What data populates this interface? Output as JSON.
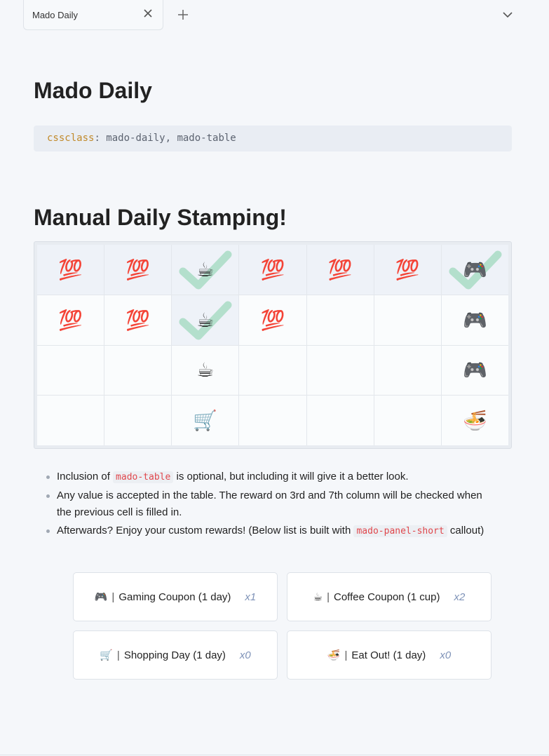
{
  "tabs": {
    "active_title": "Mado Daily",
    "close_icon": "close-icon",
    "new_tab_icon": "plus-icon",
    "menu_icon": "chevron-down-icon"
  },
  "page": {
    "title": "Mado Daily",
    "frontmatter_key": "cssclass",
    "frontmatter_sep": ":",
    "frontmatter_value": " mado-daily, mado-table",
    "heading": "Manual Daily Stamping!"
  },
  "stamp_table": {
    "rows": [
      [
        {
          "v": "💯",
          "filled": true,
          "checked": false
        },
        {
          "v": "💯",
          "filled": true,
          "checked": false
        },
        {
          "v": "☕",
          "filled": true,
          "checked": true
        },
        {
          "v": "💯",
          "filled": true,
          "checked": false
        },
        {
          "v": "💯",
          "filled": true,
          "checked": false
        },
        {
          "v": "💯",
          "filled": true,
          "checked": false
        },
        {
          "v": "🎮",
          "filled": true,
          "checked": true
        }
      ],
      [
        {
          "v": "💯",
          "filled": false,
          "checked": false
        },
        {
          "v": "💯",
          "filled": false,
          "checked": false
        },
        {
          "v": "☕",
          "filled": true,
          "checked": true
        },
        {
          "v": "💯",
          "filled": false,
          "checked": false
        },
        {
          "v": "",
          "filled": false,
          "checked": false
        },
        {
          "v": "",
          "filled": false,
          "checked": false
        },
        {
          "v": "🎮",
          "filled": false,
          "checked": false
        }
      ],
      [
        {
          "v": "",
          "filled": false,
          "checked": false
        },
        {
          "v": "",
          "filled": false,
          "checked": false
        },
        {
          "v": "☕",
          "filled": false,
          "checked": false
        },
        {
          "v": "",
          "filled": false,
          "checked": false
        },
        {
          "v": "",
          "filled": false,
          "checked": false
        },
        {
          "v": "",
          "filled": false,
          "checked": false
        },
        {
          "v": "🎮",
          "filled": false,
          "checked": false
        }
      ],
      [
        {
          "v": "",
          "filled": false,
          "checked": false
        },
        {
          "v": "",
          "filled": false,
          "checked": false
        },
        {
          "v": "🛒",
          "filled": false,
          "checked": false
        },
        {
          "v": "",
          "filled": false,
          "checked": false
        },
        {
          "v": "",
          "filled": false,
          "checked": false
        },
        {
          "v": "",
          "filled": false,
          "checked": false
        },
        {
          "v": "🍜",
          "filled": false,
          "checked": false
        }
      ]
    ]
  },
  "notes": {
    "b1_pre": "Inclusion of ",
    "b1_code": "mado-table",
    "b1_post": " is optional, but including it will give it a better look.",
    "b2": "Any value is accepted in the table. The reward on 3rd and 7th column will be checked when the previous cell is filled in.",
    "b3_pre": "Afterwards? Enjoy your custom rewards! (Below list is built with ",
    "b3_code": "mado-panel-short",
    "b3_post": " callout)"
  },
  "rewards": [
    {
      "icon": "🎮",
      "sep": "|",
      "label": "Gaming Coupon (1 day)",
      "qty": "x1"
    },
    {
      "icon": "☕",
      "sep": "|",
      "label": "Coffee Coupon (1 cup)",
      "qty": "x2"
    },
    {
      "icon": "🛒",
      "sep": "|",
      "label": "Shopping Day (1 day)",
      "qty": "x0"
    },
    {
      "icon": "🍜",
      "sep": "|",
      "label": "Eat Out! (1 day)",
      "qty": "x0"
    }
  ],
  "colors": {
    "check": "#a8dcc4",
    "inline_code": "#e0474c",
    "frontmatter_key": "#c18a2a",
    "qty": "#7f93b8"
  }
}
